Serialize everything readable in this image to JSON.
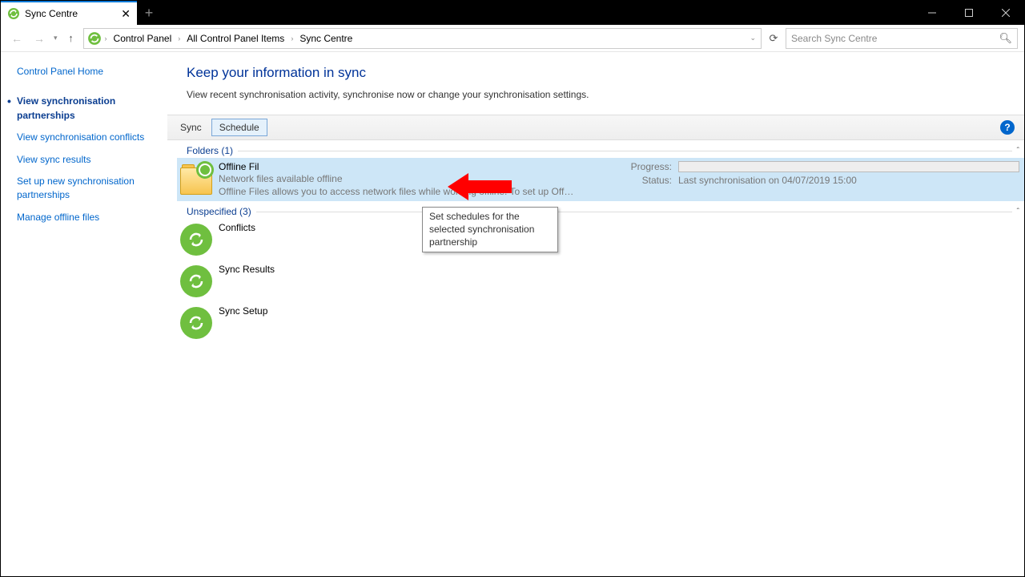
{
  "tab": {
    "title": "Sync Centre"
  },
  "breadcrumb": {
    "root": "Control Panel",
    "mid": "All Control Panel Items",
    "leaf": "Sync Centre"
  },
  "search": {
    "placeholder": "Search Sync Centre"
  },
  "sidebar": {
    "home": "Control Panel Home",
    "items": [
      "View synchronisation partnerships",
      "View synchronisation conflicts",
      "View sync results",
      "Set up new synchronisation partnerships",
      "Manage offline files"
    ]
  },
  "heading": "Keep your information in sync",
  "subtext": "View recent synchronisation activity, synchronise now or change your synchronisation settings.",
  "toolbar": {
    "sync": "Sync",
    "schedule": "Schedule"
  },
  "tooltip": "Set schedules for the selected synchronisation partnership",
  "groups": {
    "folders": {
      "label": "Folders (1)"
    },
    "unspecified": {
      "label": "Unspecified (3)"
    }
  },
  "offline": {
    "title": "Offline Fil",
    "sub1": "Network files available offline",
    "sub2": "Offline Files allows you to access network files while working offline. To set up Off…",
    "progress_label": "Progress:",
    "status_label": "Status:",
    "status_value": "Last synchronisation on 04/07/2019 15:00"
  },
  "unspec_items": [
    "Conflicts",
    "Sync Results",
    "Sync Setup"
  ]
}
